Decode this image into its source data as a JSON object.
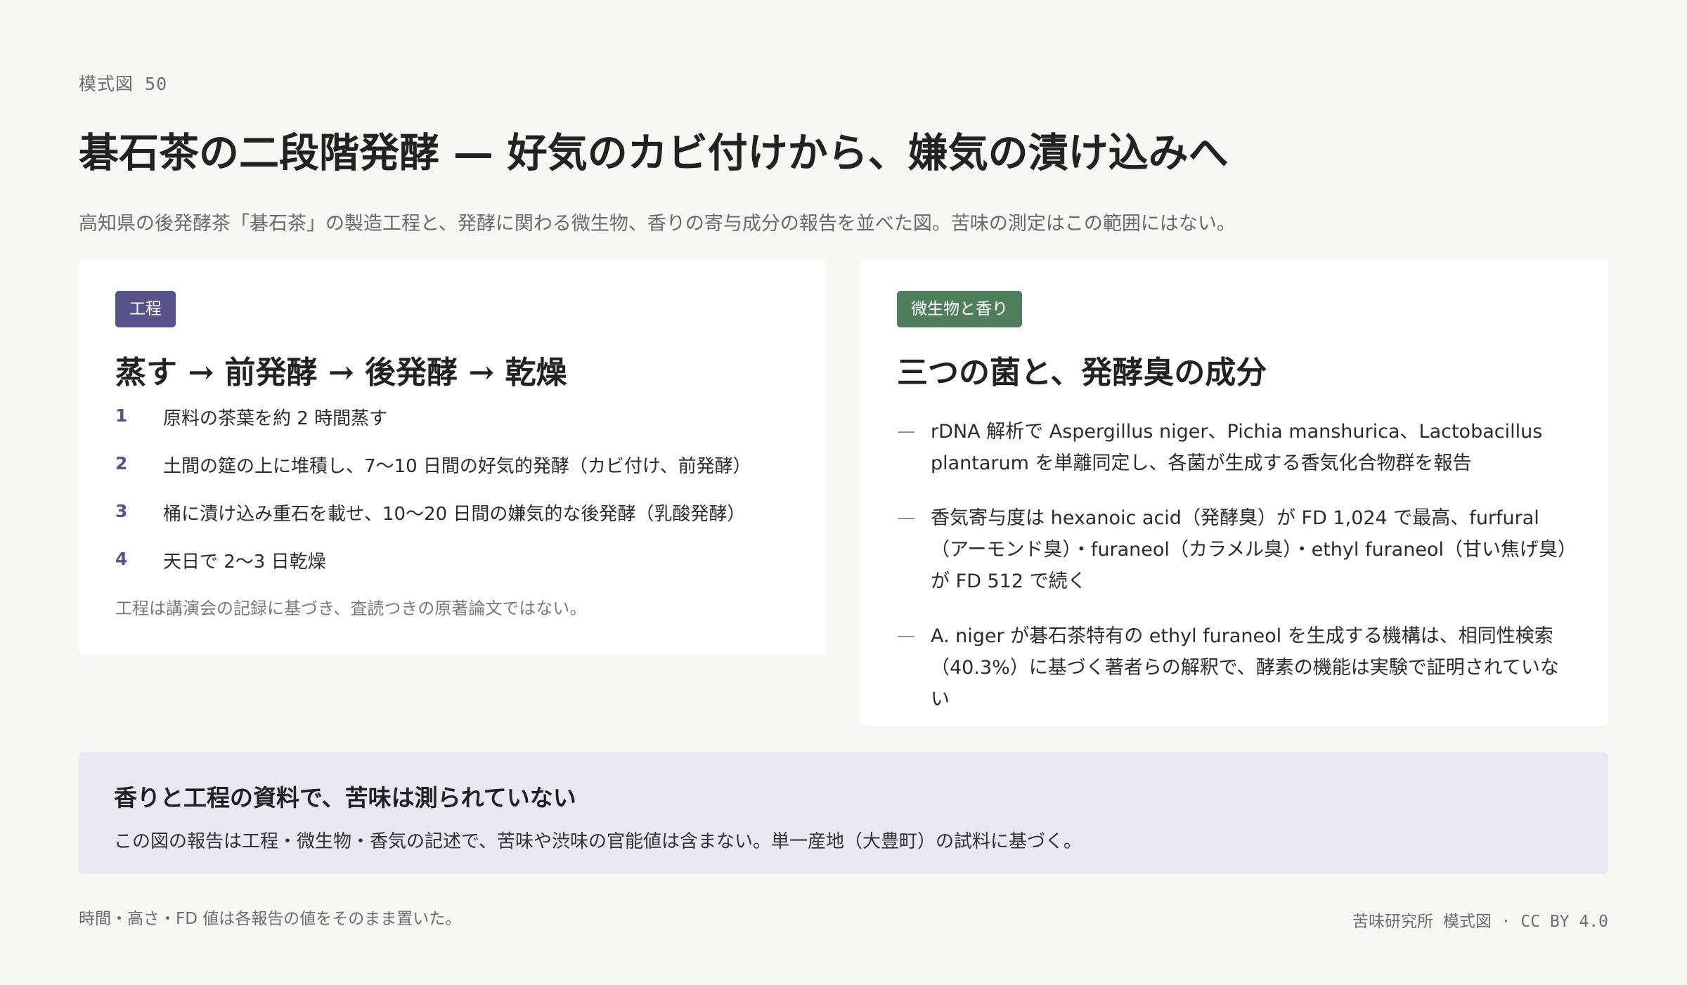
{
  "header": {
    "figure_label": "模式図 50",
    "title": "碁石茶の二段階発酵 — 好気のカビ付けから、嫌気の漬け込みへ",
    "subtitle": "高知県の後発酵茶「碁石茶」の製造工程と、発酵に関わる微生物、香りの寄与成分の報告を並べた図。苦味の測定はこの範囲にはない。"
  },
  "process_card": {
    "tag": "工程",
    "heading": "蒸す → 前発酵 → 後発酵 → 乾燥",
    "steps": [
      {
        "num": "1",
        "text": "原料の茶葉を約 2 時間蒸す"
      },
      {
        "num": "2",
        "text": "土間の筵の上に堆積し、7〜10 日間の好気的発酵（カビ付け、前発酵）"
      },
      {
        "num": "3",
        "text": "桶に漬け込み重石を載せ、10〜20 日間の嫌気的な後発酵（乳酸発酵）"
      },
      {
        "num": "4",
        "text": "天日で 2〜3 日乾燥"
      }
    ],
    "note": "工程は講演会の記録に基づき、査読つきの原著論文ではない。"
  },
  "microbe_card": {
    "tag": "微生物と香り",
    "heading": "三つの菌と、発酵臭の成分",
    "dash": "—",
    "facts": [
      "rDNA 解析で Aspergillus niger、Pichia manshurica、Lactobacillus plantarum を単離同定し、各菌が生成する香気化合物群を報告",
      "香気寄与度は hexanoic acid（発酵臭）が FD 1,024 で最高、furfural（アーモンド臭）・furaneol（カラメル臭）・ethyl furaneol（甘い焦げ臭）が FD 512 で続く",
      "A. niger が碁石茶特有の ethyl furaneol を生成する機構は、相同性検索（40.3%）に基づく著者らの解釈で、酵素の機能は実験で証明されていない"
    ]
  },
  "summary": {
    "title": "香りと工程の資料で、苦味は測られていない",
    "text": "この図の報告は工程・微生物・香気の記述で、苦味や渋味の官能値は含まない。単一産地（大豊町）の試料に基づく。"
  },
  "footer": {
    "note": "時間・高さ・FD 値は各報告の値をそのまま置いた。",
    "credit": "苦味研究所 模式図 · CC BY 4.0"
  },
  "colors": {
    "background": "#f6f6f2",
    "process_accent": "#56528a",
    "microbe_accent": "#4f7e5c",
    "summary_background": "#e9e8f2"
  }
}
